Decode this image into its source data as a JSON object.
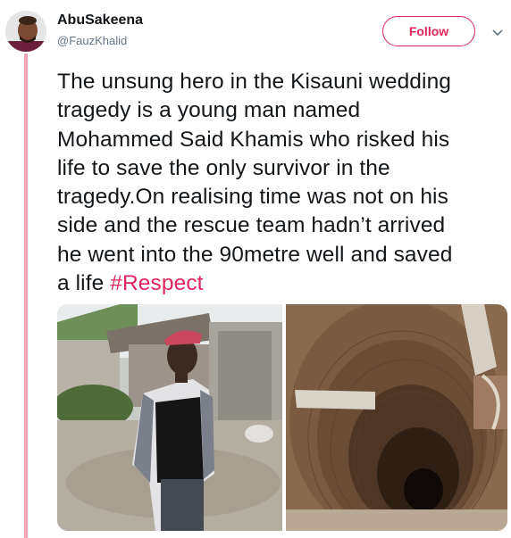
{
  "user": {
    "display_name": "AbuSakeena",
    "handle": "@FauzKhalid"
  },
  "follow_label": "Follow",
  "tweet": {
    "lines": [
      "The unsung hero in the Kisauni wedding",
      "tragedy is a young man named",
      "Mohammed Said Khamis who risked his",
      "life to save the only survivor in the",
      "tragedy.On realising time was not on his",
      "side and the rescue team hadn’t arrived",
      "he went into the 90metre well and saved"
    ],
    "last_line_prefix": "a life",
    "hashtag": "#Respect"
  },
  "colors": {
    "accent": "#e0245e",
    "thread_line": "#f4a6b5",
    "text": "#14171a",
    "muted": "#657786"
  },
  "icons": {
    "more_menu": "chevron-down-icon"
  }
}
